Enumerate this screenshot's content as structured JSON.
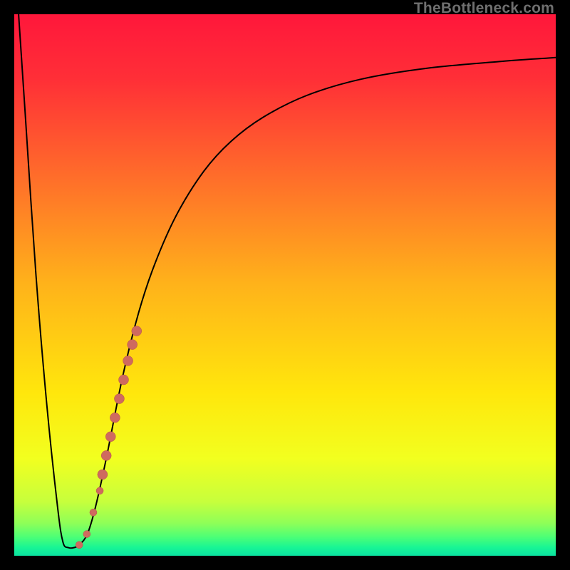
{
  "watermark": "TheBottleneck.com",
  "colors": {
    "frame": "#000000",
    "curve": "#000000",
    "marker_fill": "#cf6a5f",
    "marker_stroke": "#b55047",
    "gradient_stops": [
      {
        "offset": 0.0,
        "color": "#ff173b"
      },
      {
        "offset": 0.12,
        "color": "#ff2f37"
      },
      {
        "offset": 0.3,
        "color": "#ff6d2a"
      },
      {
        "offset": 0.5,
        "color": "#ffb31a"
      },
      {
        "offset": 0.7,
        "color": "#ffe70c"
      },
      {
        "offset": 0.82,
        "color": "#f2ff1f"
      },
      {
        "offset": 0.9,
        "color": "#c7ff3c"
      },
      {
        "offset": 0.94,
        "color": "#8eff58"
      },
      {
        "offset": 0.965,
        "color": "#4dff76"
      },
      {
        "offset": 0.985,
        "color": "#17f595"
      },
      {
        "offset": 1.0,
        "color": "#0be3a0"
      }
    ]
  },
  "chart_data": {
    "type": "line",
    "title": "",
    "xlabel": "",
    "ylabel": "",
    "xlim": [
      0,
      100
    ],
    "ylim": [
      0,
      100
    ],
    "note": "x = relative rating/position (0–100 across plot width); y = bottleneck percentage (0 at bottom, 100 at top). Curve dives from ~100% at x≈0 to ~0% near x≈10, then rises asymptotically toward ~92% at x=100.",
    "series": [
      {
        "name": "bottleneck-curve",
        "x": [
          0.8,
          2,
          4,
          6,
          8,
          9,
          10,
          11,
          12,
          13.5,
          15,
          17,
          20,
          23,
          26,
          30,
          35,
          40,
          46,
          54,
          64,
          76,
          90,
          100
        ],
        "y": [
          100,
          82,
          52,
          28,
          9,
          2.5,
          1.5,
          1.5,
          2,
          4,
          9,
          18,
          33,
          45,
          54,
          63,
          71,
          76.5,
          81,
          85,
          88,
          90,
          91.3,
          92
        ]
      }
    ],
    "markers": {
      "name": "highlighted-range",
      "description": "salmon dotted segment on the rising branch",
      "points": [
        {
          "x": 12.0,
          "y": 2.0,
          "r": 5
        },
        {
          "x": 13.4,
          "y": 4.0,
          "r": 5
        },
        {
          "x": 14.6,
          "y": 8.0,
          "r": 5
        },
        {
          "x": 15.8,
          "y": 12.0,
          "r": 5
        },
        {
          "x": 16.3,
          "y": 15.0,
          "r": 7
        },
        {
          "x": 17.0,
          "y": 18.5,
          "r": 7
        },
        {
          "x": 17.8,
          "y": 22.0,
          "r": 7
        },
        {
          "x": 18.6,
          "y": 25.5,
          "r": 7
        },
        {
          "x": 19.4,
          "y": 29.0,
          "r": 7
        },
        {
          "x": 20.2,
          "y": 32.5,
          "r": 7
        },
        {
          "x": 21.0,
          "y": 36.0,
          "r": 7
        },
        {
          "x": 21.8,
          "y": 39.0,
          "r": 7
        },
        {
          "x": 22.6,
          "y": 41.5,
          "r": 7
        }
      ]
    }
  }
}
